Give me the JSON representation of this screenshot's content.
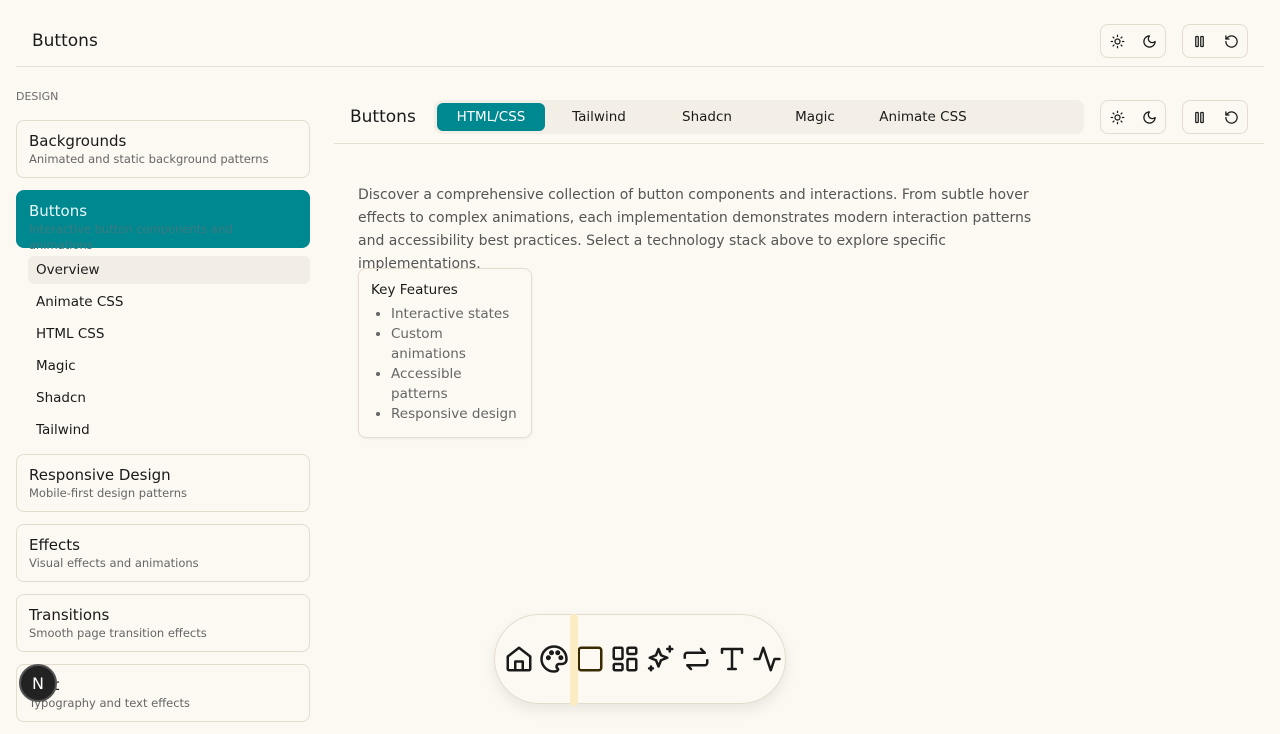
{
  "header": {
    "title": "Buttons"
  },
  "sidebar": {
    "section": "DESIGN",
    "cards": [
      {
        "name": "Backgrounds",
        "desc": "Animated and static background patterns"
      },
      {
        "name": "Buttons",
        "desc": "Interactive button components and animations"
      },
      {
        "name": "Responsive Design",
        "desc": "Mobile-first design patterns"
      },
      {
        "name": "Effects",
        "desc": "Visual effects and animations"
      },
      {
        "name": "Transitions",
        "desc": "Smooth page transition effects"
      },
      {
        "name": "Text",
        "desc": "Typography and text effects"
      }
    ],
    "subitems": [
      "Overview",
      "Animate CSS",
      "HTML CSS",
      "Magic",
      "Shadcn",
      "Tailwind"
    ]
  },
  "main": {
    "title": "Buttons",
    "tabs": [
      "HTML/CSS",
      "Tailwind",
      "Shadcn",
      "Magic",
      "Animate CSS"
    ],
    "description": "Discover a comprehensive collection of button components and interactions. From subtle hover effects to complex animations, each implementation demonstrates modern interaction patterns and accessibility best practices. Select a technology stack above to explore specific implementations.",
    "features_title": "Key Features",
    "features": [
      "Interactive states",
      "Custom animations",
      "Accessible patterns",
      "Responsive design"
    ]
  },
  "avatar": "N",
  "colors": {
    "accent": "#008891",
    "background": "#fcf9f2"
  }
}
